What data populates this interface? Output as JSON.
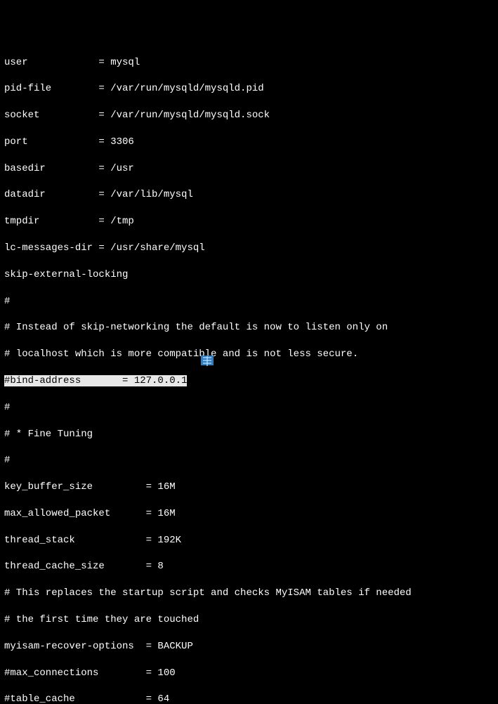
{
  "lines": {
    "l00": "user            = mysql",
    "l01": "pid-file        = /var/run/mysqld/mysqld.pid",
    "l02": "socket          = /var/run/mysqld/mysqld.sock",
    "l03": "port            = 3306",
    "l04": "basedir         = /usr",
    "l05": "datadir         = /var/lib/mysql",
    "l06": "tmpdir          = /tmp",
    "l07": "lc-messages-dir = /usr/share/mysql",
    "l08": "skip-external-locking",
    "l09": "#",
    "l10": "# Instead of skip-networking the default is now to listen only on",
    "l11a": "# localhost which is more compati",
    "l11b": "b",
    "l11c": "le and is not less secure.",
    "l12": "#bind-address       = 127.0.0.1",
    "l13": "#",
    "l14": "# * Fine Tuning",
    "l15": "#",
    "l16": "key_buffer_size         = 16M",
    "l17": "max_allowed_packet      = 16M",
    "l18": "thread_stack            = 192K",
    "l19": "thread_cache_size       = 8",
    "l20": "# This replaces the startup script and checks MyISAM tables if needed",
    "l21": "# the first time they are touched",
    "l22": "myisam-recover-options  = BACKUP",
    "l23": "#max_connections        = 100",
    "l24": "#table_cache            = 64"
  }
}
